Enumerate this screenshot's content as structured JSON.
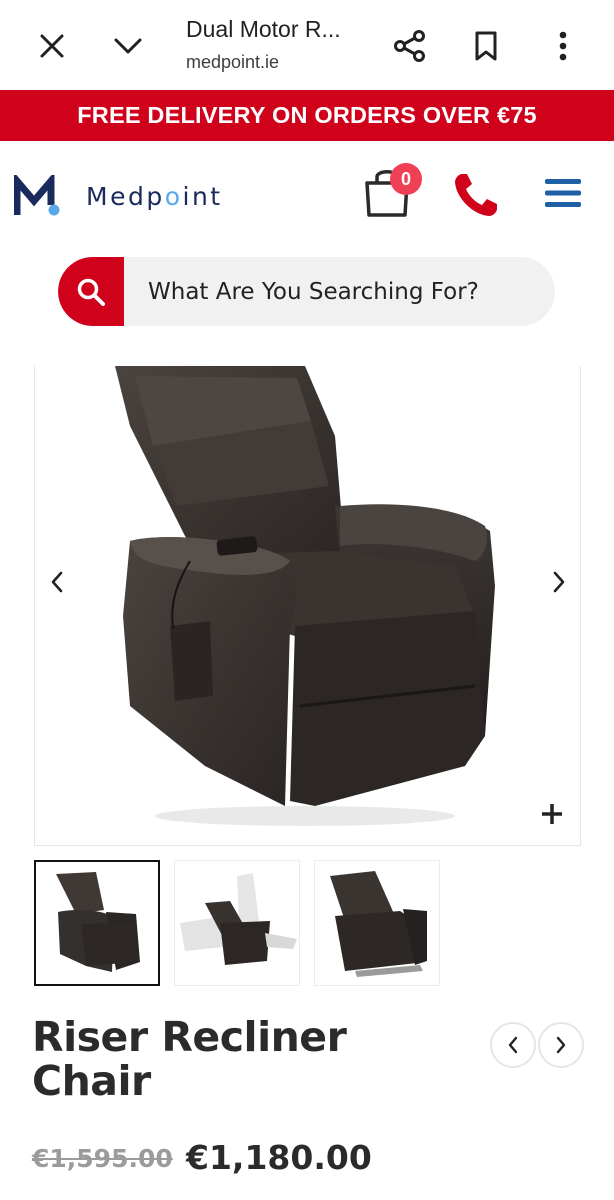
{
  "browser": {
    "title": "Dual Motor R...",
    "domain": "medpoint.ie",
    "icons": [
      "close-icon",
      "chevron-down-icon",
      "share-icon",
      "bookmark-icon",
      "more-vert-icon"
    ]
  },
  "banner": {
    "text": "FREE DELIVERY ON ORDERS OVER €75"
  },
  "header": {
    "logo_text_before": "Medp",
    "logo_text_dot": "o",
    "logo_text_after": "int",
    "cart_count": "0",
    "icons": [
      "cart-icon",
      "phone-icon",
      "menu-icon"
    ]
  },
  "search": {
    "placeholder": "What Are You Searching For?"
  },
  "gallery": {
    "thumbnail_count": 3,
    "active_thumbnail": 1
  },
  "product": {
    "title": "Riser Recliner Chair",
    "old_price": "€1,595.00",
    "price": "€1,180.00"
  },
  "colors": {
    "brand_red": "#d0021b",
    "brand_navy": "#1b2a5c",
    "menu_blue": "#1f5fa6",
    "badge_red": "#ef4056"
  }
}
